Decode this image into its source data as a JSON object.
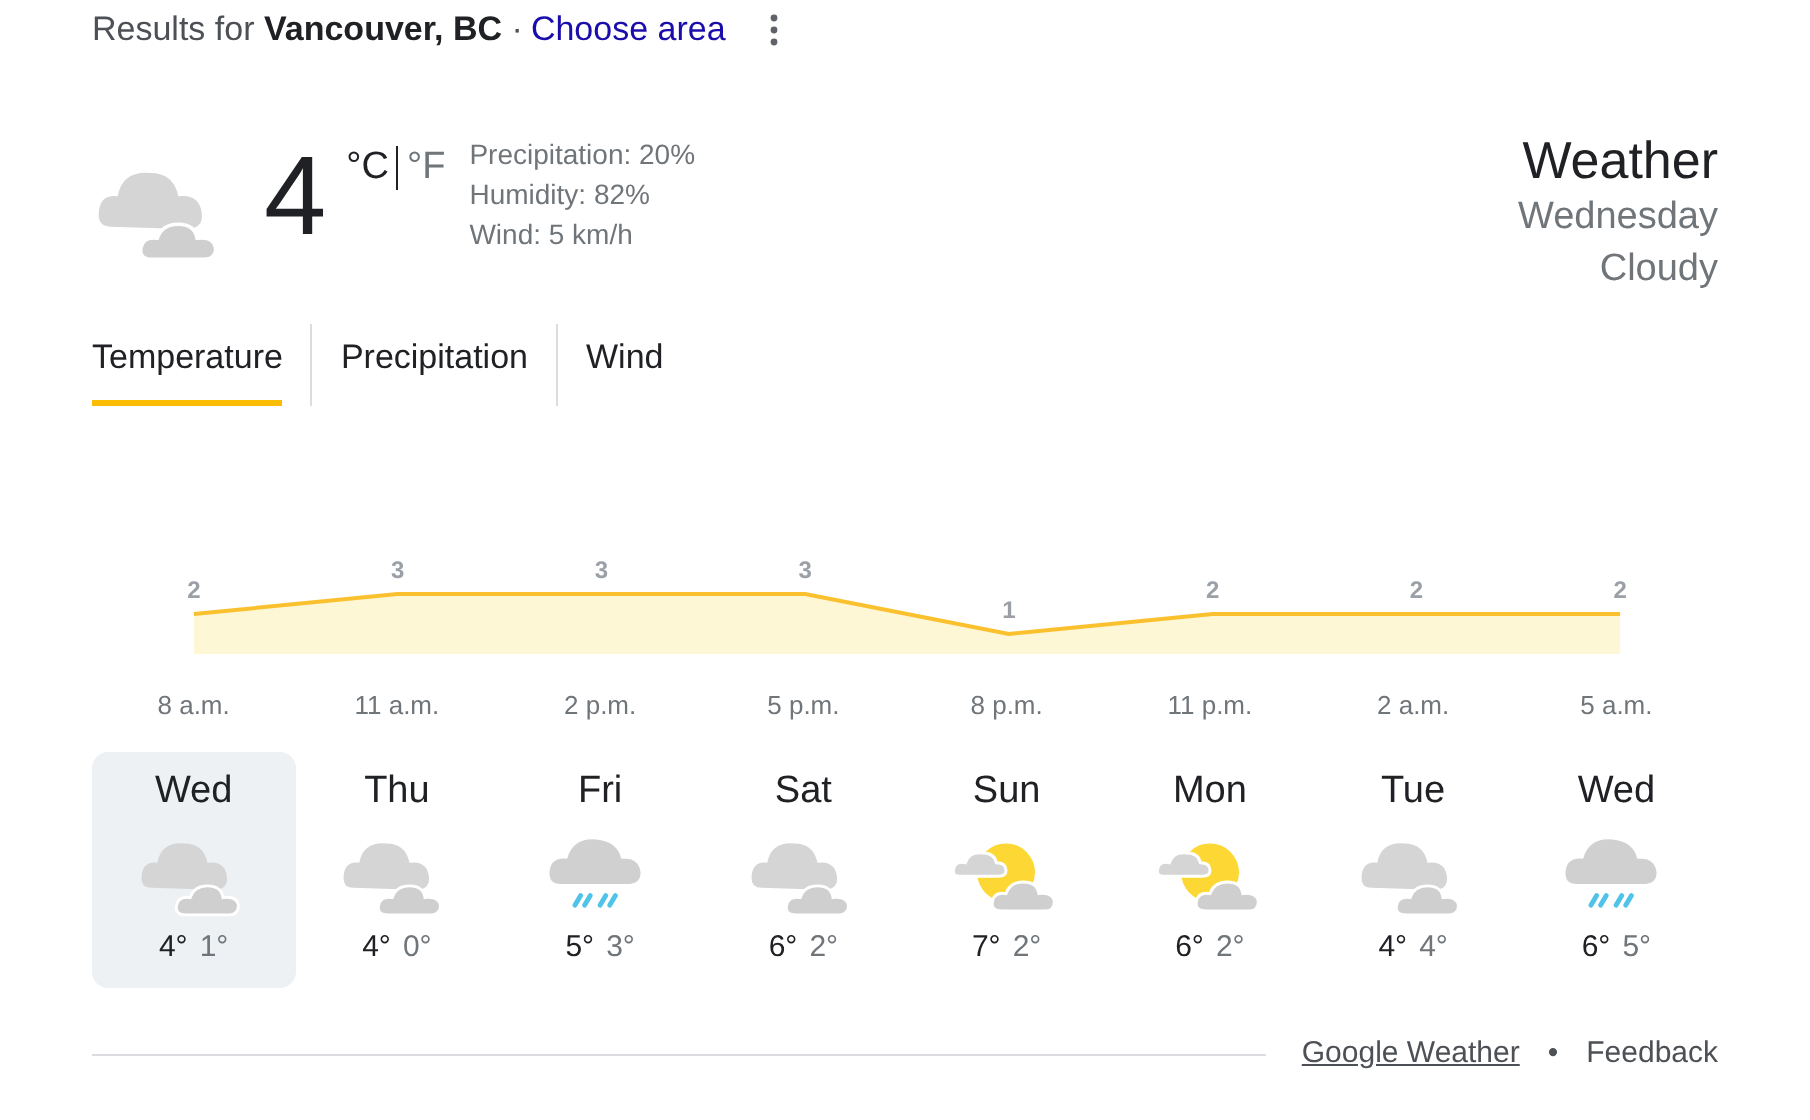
{
  "header": {
    "prefix": "Results for",
    "location": "Vancouver, BC",
    "separator": "·",
    "link": "Choose area"
  },
  "current": {
    "kind": "cloudy",
    "temperature": "4",
    "unit_c": "°C",
    "unit_f": "°F",
    "unit_c_selected": true,
    "details": [
      "Precipitation: 20%",
      "Humidity: 82%",
      "Wind: 5 km/h"
    ]
  },
  "summary": {
    "title": "Weather",
    "day": "Wednesday",
    "condition": "Cloudy"
  },
  "tabs": [
    {
      "label": "Temperature",
      "selected": true
    },
    {
      "label": "Precipitation",
      "selected": false
    },
    {
      "label": "Wind",
      "selected": false
    }
  ],
  "chart_data": {
    "type": "area",
    "categories": [
      "8 a.m.",
      "11 a.m.",
      "2 p.m.",
      "5 p.m.",
      "8 p.m.",
      "11 p.m.",
      "2 a.m.",
      "5 a.m."
    ],
    "series": [
      {
        "color": "#fbc02d",
        "values": [
          2,
          3,
          3,
          3,
          1,
          2,
          2,
          2
        ]
      }
    ],
    "data_labels": true
  },
  "days": [
    {
      "day": "Wed",
      "kind": "cloudy",
      "high": "4°",
      "low": "1°",
      "selected": true
    },
    {
      "day": "Thu",
      "kind": "cloudy",
      "high": "4°",
      "low": "0°",
      "selected": false
    },
    {
      "day": "Fri",
      "kind": "rain",
      "high": "5°",
      "low": "3°",
      "selected": false
    },
    {
      "day": "Sat",
      "kind": "cloudy",
      "high": "6°",
      "low": "2°",
      "selected": false
    },
    {
      "day": "Sun",
      "kind": "partly",
      "high": "7°",
      "low": "2°",
      "selected": false
    },
    {
      "day": "Mon",
      "kind": "partly",
      "high": "6°",
      "low": "2°",
      "selected": false
    },
    {
      "day": "Tue",
      "kind": "cloudy",
      "high": "4°",
      "low": "4°",
      "selected": false
    },
    {
      "day": "Wed",
      "kind": "rain",
      "high": "6°",
      "low": "5°",
      "selected": false
    }
  ],
  "footer": {
    "link": "Google Weather",
    "separator": "•",
    "feedback": "Feedback"
  }
}
